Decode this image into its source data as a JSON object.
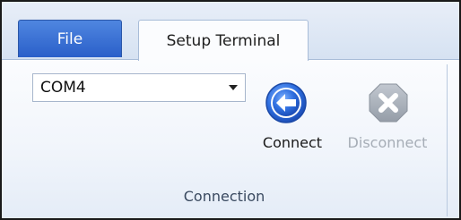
{
  "tabs": {
    "file_label": "File",
    "setup_label": "Setup Terminal"
  },
  "connection": {
    "port_value": "COM4",
    "connect_label": "Connect",
    "disconnect_label": "Disconnect",
    "group_label": "Connection"
  },
  "colors": {
    "file_tab": "#2a5fc9",
    "connect_icon": "#2f6fe0",
    "disconnect_icon": "#aab2bc"
  },
  "icons": {
    "connect": "arrow-left-circle-icon",
    "disconnect": "x-octagon-icon"
  }
}
